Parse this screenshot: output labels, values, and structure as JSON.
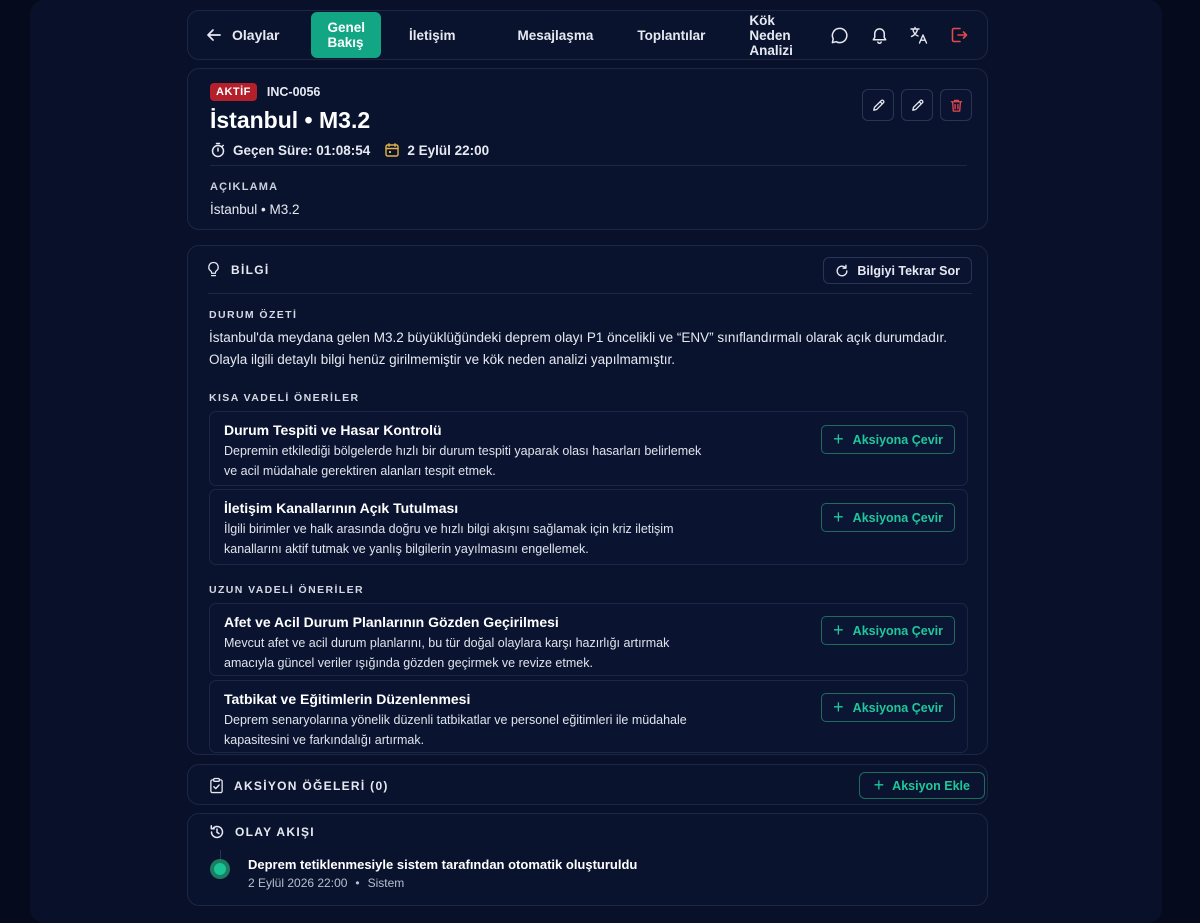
{
  "nav": {
    "back_label": "Olaylar",
    "tabs": [
      {
        "label": "Genel Bakış",
        "active": true
      },
      {
        "label": "İletişim",
        "active": false
      },
      {
        "label": "Mesajlaşma",
        "active": false
      },
      {
        "label": "Toplantılar",
        "active": false
      },
      {
        "label": "Kök Neden Analizi",
        "active": false
      }
    ],
    "icons": [
      "chat-icon",
      "bell-icon",
      "translate-icon",
      "logout-icon"
    ]
  },
  "incident": {
    "status": "AKTİF",
    "id": "INC-0056",
    "title": "İstanbul • M3.2",
    "elapsed": "Geçen Süre: 01:08:54",
    "date": "2 Eylül 22:00",
    "description_label": "AÇIKLAMA",
    "description": "İstanbul  •  M3.2"
  },
  "info": {
    "heading": "BİLGİ",
    "refresh_label": "Bilgiyi Tekrar Sor",
    "summary_label": "DURUM ÖZETİ",
    "summary": "İstanbul'da meydana gelen M3.2 büyüklüğündeki deprem olayı P1 öncelikli ve “ENV” sınıflandırmalı olarak açık durumdadır. Olayla ilgili detaylı bilgi henüz girilmemiştir ve kök neden analizi yapılmamıştır.",
    "short_term_label": "KISA VADELİ ÖNERİLER",
    "long_term_label": "UZUN VADELİ ÖNERİLER",
    "convert_label": "Aksiyona Çevir",
    "short_term": [
      {
        "title": "Durum Tespiti ve Hasar Kontrolü",
        "desc": "Depremin etkilediği bölgelerde hızlı bir durum tespiti yaparak olası hasarları belirlemek ve acil müdahale gerektiren alanları tespit etmek."
      },
      {
        "title": "İletişim Kanallarının Açık Tutulması",
        "desc": "İlgili birimler ve halk arasında doğru ve hızlı bilgi akışını sağlamak için kriz iletişim kanallarını aktif tutmak ve yanlış bilgilerin yayılmasını engellemek."
      }
    ],
    "long_term": [
      {
        "title": "Afet ve Acil Durum Planlarının Gözden Geçirilmesi",
        "desc": "Mevcut afet ve acil durum planlarını, bu tür doğal olaylara karşı hazırlığı artırmak amacıyla güncel veriler ışığında gözden geçirmek ve revize etmek."
      },
      {
        "title": "Tatbikat ve Eğitimlerin Düzenlenmesi",
        "desc": "Deprem senaryolarına yönelik düzenli tatbikatlar ve personel eğitimleri ile müdahale kapasitesini ve farkındalığı artırmak."
      }
    ]
  },
  "actions": {
    "heading": "AKSİYON ÖĞELERİ (0)",
    "add_label": "Aksiyon Ekle"
  },
  "timeline": {
    "heading": "OLAY AKIŞI",
    "events": [
      {
        "title": "Deprem tetiklenmesiyle sistem tarafından otomatik oluşturuldu",
        "time": "2 Eylül 2026 22:00",
        "sep": "•",
        "source": "Sistem"
      }
    ]
  },
  "colors": {
    "accent": "#12a684",
    "accent_text": "#20c79b",
    "danger": "#b3202c",
    "background": "#050b1c"
  }
}
